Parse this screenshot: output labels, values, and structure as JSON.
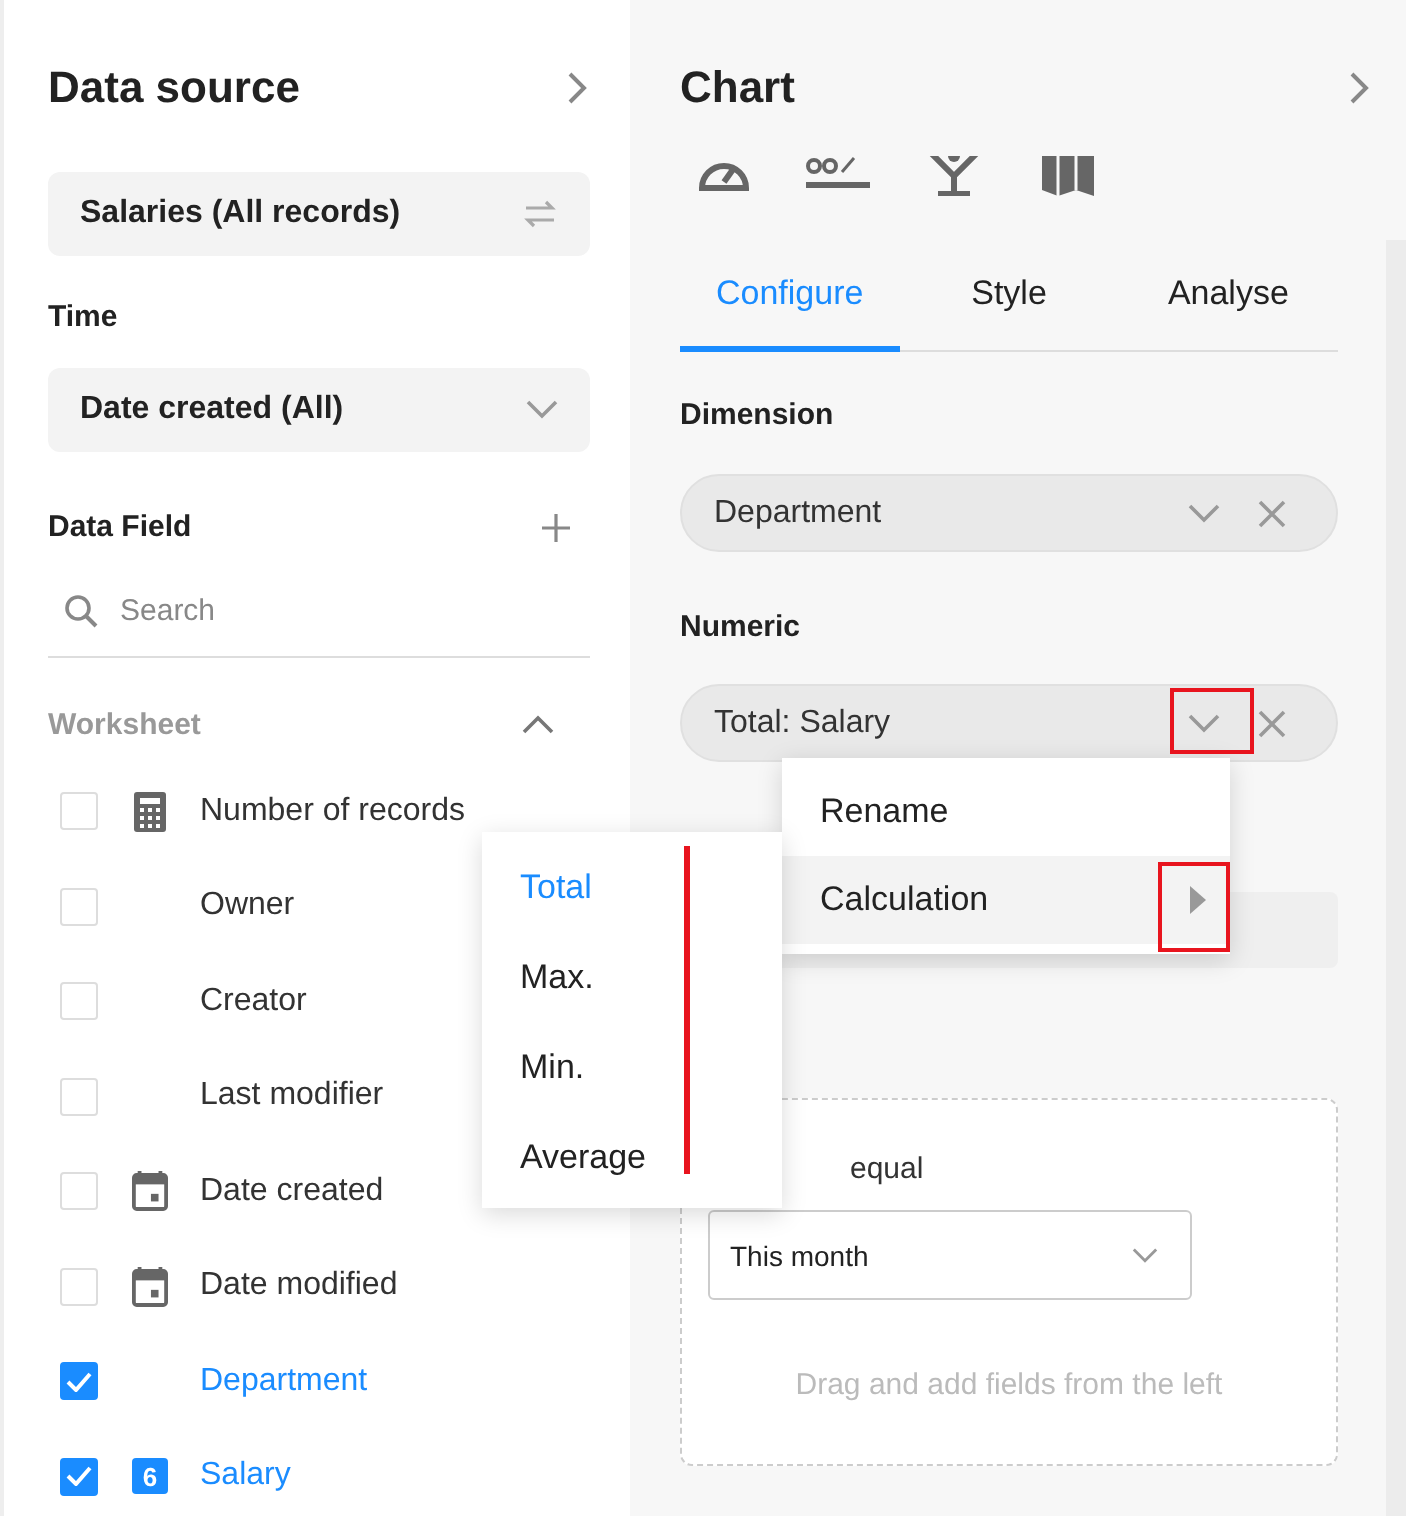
{
  "data_source": {
    "title": "Data source",
    "source": "Salaries (All records)",
    "time_label": "Time",
    "time_value": "Date created (All)",
    "data_field_label": "Data Field",
    "search": {
      "placeholder": "Search"
    },
    "group": {
      "label": "Worksheet",
      "expanded": true
    },
    "fields": [
      {
        "label": "Number of records",
        "kind": "count",
        "checked": false
      },
      {
        "label": "Owner",
        "kind": "text",
        "checked": false
      },
      {
        "label": "Creator",
        "kind": "text",
        "checked": false
      },
      {
        "label": "Last modifier",
        "kind": "text",
        "checked": false
      },
      {
        "label": "Date created",
        "kind": "date",
        "checked": false
      },
      {
        "label": "Date modified",
        "kind": "date",
        "checked": false
      },
      {
        "label": "Department",
        "kind": "text",
        "checked": true
      },
      {
        "label": "Salary",
        "kind": "number",
        "checked": true,
        "icon_text": "6"
      }
    ]
  },
  "chart": {
    "title": "Chart",
    "tabs": [
      {
        "label": "Configure",
        "selected": true
      },
      {
        "label": "Style",
        "selected": false
      },
      {
        "label": "Analyse",
        "selected": false
      }
    ],
    "dimension_label": "Dimension",
    "dimension": "Department",
    "numeric_label": "Numeric",
    "numeric": "Total: Salary",
    "filter": {
      "operator": "equal",
      "value": "This month",
      "hint": "Drag and add fields from the left"
    }
  },
  "menu": {
    "items": [
      {
        "label": "Rename",
        "has_submenu": false,
        "highlighted": false
      },
      {
        "label": "Calculation",
        "has_submenu": true,
        "highlighted": true
      }
    ]
  },
  "submenu": {
    "items": [
      {
        "label": "Total",
        "selected": true
      },
      {
        "label": "Max.",
        "selected": false
      },
      {
        "label": "Min.",
        "selected": false
      },
      {
        "label": "Average",
        "selected": false
      }
    ]
  }
}
